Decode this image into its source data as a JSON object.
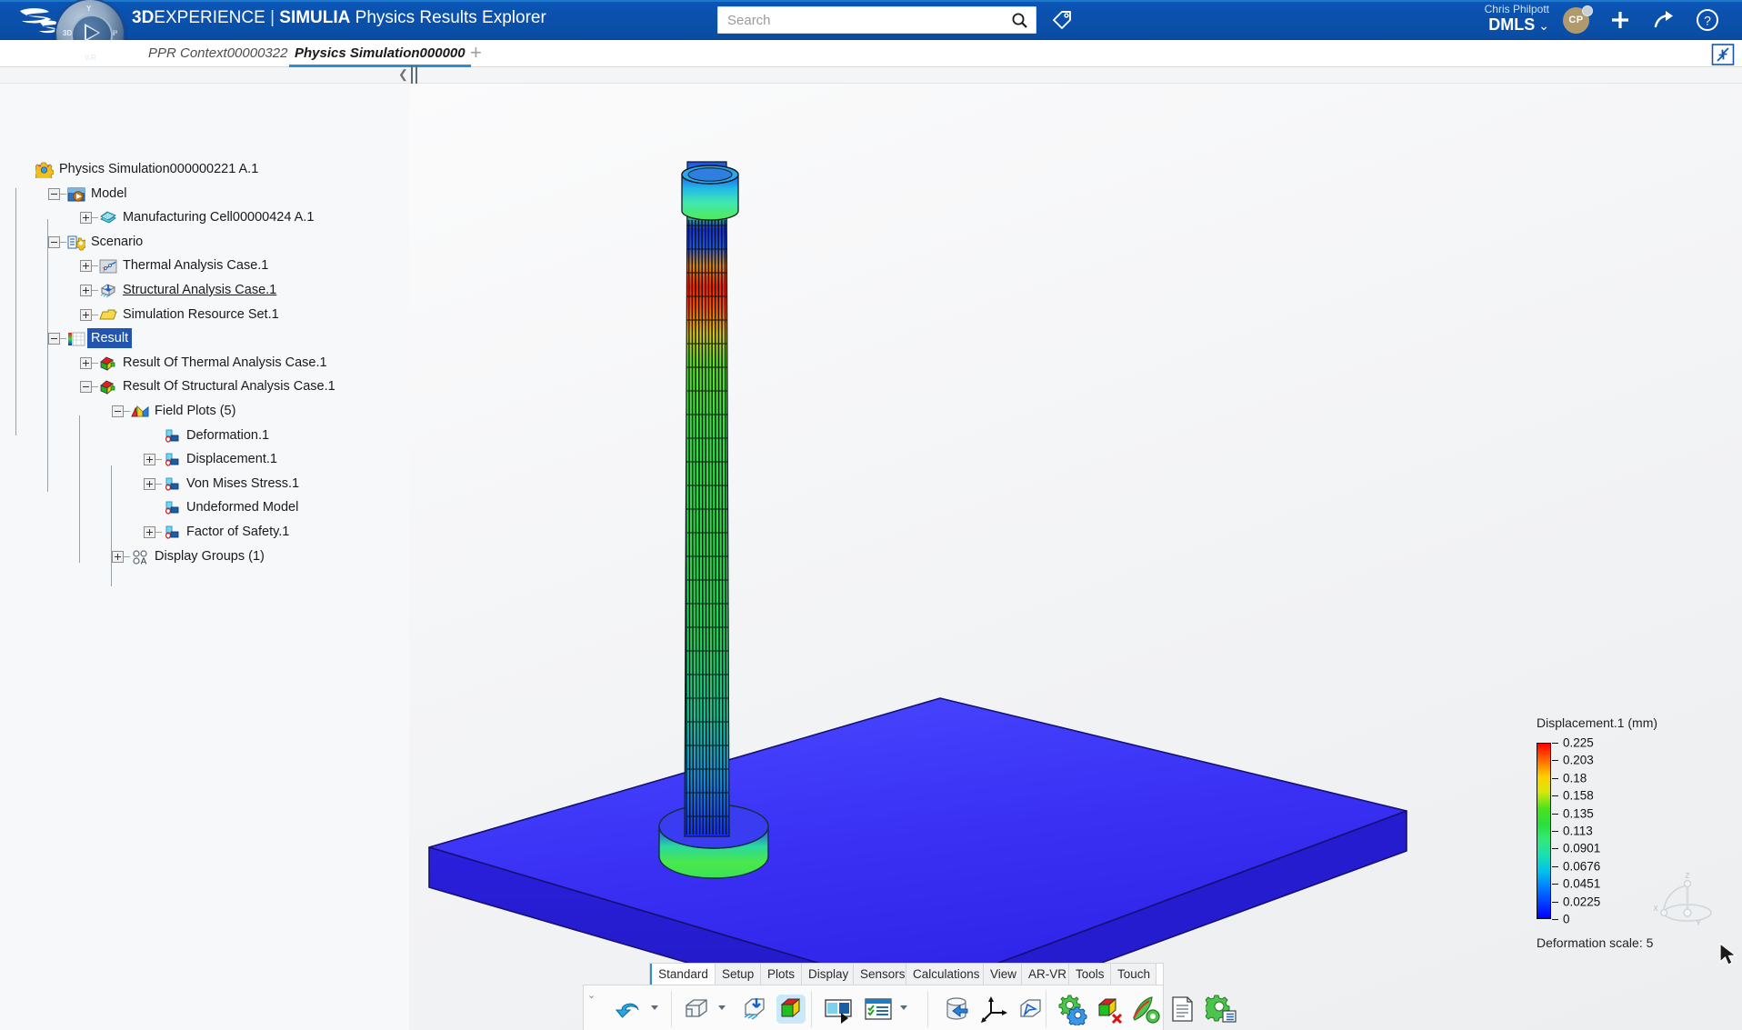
{
  "topbar": {
    "brand_bold": "3D",
    "brand_rest": "EXPERIENCE",
    "brand_sep": "|",
    "brand_product": "SIMULIA",
    "brand_app": "Physics Results Explorer",
    "compass_labels": {
      "n": "Y",
      "w": "3D",
      "e": "i³",
      "s": "V,R"
    },
    "search_placeholder": "Search",
    "search_value": "",
    "user_name": "Chris Philpott",
    "user_org": "DMLS",
    "avatar_initials": "CP",
    "icons": {
      "search": "search-icon",
      "tag": "tag-icon",
      "plus": "plus-icon",
      "share": "share-icon",
      "help": "help-icon",
      "collapse": "collapse-icon"
    }
  },
  "tabs": {
    "inactive_label": "PPR Context00000322",
    "active_label": "Physics Simulation000000",
    "add_label": "+"
  },
  "tree": {
    "nodes": [
      {
        "label": "Physics Simulation000000221 A.1",
        "indent": 0,
        "icon": "simulation-gear-icon",
        "expander": "none",
        "state": "normal"
      },
      {
        "label": "Model",
        "indent": 1,
        "icon": "model-play-icon",
        "expander": "minus",
        "state": "normal"
      },
      {
        "label": "Manufacturing Cell00000424 A.1",
        "indent": 2,
        "icon": "manufacturing-cell-icon",
        "expander": "plus",
        "state": "normal"
      },
      {
        "label": "Scenario",
        "indent": 1,
        "icon": "scenario-icon",
        "expander": "minus",
        "state": "normal"
      },
      {
        "label": "Thermal Analysis Case.1",
        "indent": 2,
        "icon": "thermal-case-icon",
        "expander": "plus",
        "state": "normal"
      },
      {
        "label": "Structural Analysis Case.1",
        "indent": 2,
        "icon": "structural-case-icon",
        "expander": "plus",
        "state": "underline"
      },
      {
        "label": "Simulation Resource Set.1",
        "indent": 2,
        "icon": "folder-icon",
        "expander": "plus",
        "state": "normal"
      },
      {
        "label": "Result",
        "indent": 1,
        "icon": "result-icon",
        "expander": "minus",
        "state": "selected"
      },
      {
        "label": "Result Of Thermal Analysis Case.1",
        "indent": 2,
        "icon": "result-cube-icon",
        "expander": "plus",
        "state": "normal"
      },
      {
        "label": "Result Of Structural Analysis Case.1",
        "indent": 2,
        "icon": "result-cube-icon",
        "expander": "minus",
        "state": "normal"
      },
      {
        "label": "Field Plots (5)",
        "indent": 3,
        "icon": "field-plots-icon",
        "expander": "minus",
        "state": "normal"
      },
      {
        "label": "Deformation.1",
        "indent": 4,
        "icon": "plot-icon",
        "expander": "none",
        "state": "normal"
      },
      {
        "label": "Displacement.1",
        "indent": 4,
        "icon": "plot-icon",
        "expander": "plus",
        "state": "normal"
      },
      {
        "label": "Von Mises Stress.1",
        "indent": 4,
        "icon": "plot-icon",
        "expander": "plus",
        "state": "normal"
      },
      {
        "label": "Undeformed Model",
        "indent": 4,
        "icon": "plot-icon",
        "expander": "none",
        "state": "normal"
      },
      {
        "label": "Factor of Safety.1",
        "indent": 4,
        "icon": "plot-icon",
        "expander": "plus",
        "state": "normal"
      },
      {
        "label": "Display Groups (1)",
        "indent": 3,
        "icon": "display-groups-icon",
        "expander": "plus",
        "state": "normal"
      }
    ]
  },
  "legend": {
    "title": "Displacement.1 (mm)",
    "values": [
      "0.225",
      "0.203",
      "0.18",
      "0.158",
      "0.135",
      "0.113",
      "0.0901",
      "0.0676",
      "0.0451",
      "0.0225",
      "0"
    ],
    "deformation_scale_label": "Deformation scale: 5",
    "colors": {
      "max": "#ff0000",
      "mid": "#33e878",
      "min": "#0000ff"
    }
  },
  "triad": {
    "x": "X",
    "y": "Y",
    "z": "Z"
  },
  "bottom_toolbar": {
    "tabs": [
      {
        "label": "Standard",
        "active": true
      },
      {
        "label": "Setup",
        "active": false
      },
      {
        "label": "Plots",
        "active": false
      },
      {
        "label": "Display",
        "active": false
      },
      {
        "label": "Sensors",
        "active": false
      },
      {
        "label": "Calculations",
        "active": false
      },
      {
        "label": "View",
        "active": false
      },
      {
        "label": "AR-VR",
        "active": false
      },
      {
        "label": "Tools",
        "active": false
      },
      {
        "label": "Touch",
        "active": false
      }
    ],
    "buttons": [
      {
        "name": "undo-icon",
        "title": "Undo"
      },
      {
        "name": "import-shape-icon",
        "title": "Shape"
      },
      {
        "name": "import-result-icon",
        "title": "Import Result"
      },
      {
        "name": "color-plot-icon",
        "title": "Color Plot"
      },
      {
        "name": "animation-icon",
        "title": "Animation"
      },
      {
        "name": "plot-list-icon",
        "title": "Plot List"
      },
      {
        "name": "database-import-icon",
        "title": "Load Database"
      },
      {
        "name": "axis-triad-icon",
        "title": "Axis System"
      },
      {
        "name": "probe-icon",
        "title": "Probe"
      },
      {
        "name": "settings-gears-icon",
        "title": "Settings"
      },
      {
        "name": "delete-plot-icon",
        "title": "Delete Plot"
      },
      {
        "name": "annotate-icon",
        "title": "Annotate"
      },
      {
        "name": "report-icon",
        "title": "Report"
      },
      {
        "name": "options-list-icon",
        "title": "Options"
      }
    ]
  },
  "viewport": {
    "model_description": "Deformed lattice column on base plate, colored by displacement",
    "base_plate_color": "#3333ff",
    "background": "#f2f3f5"
  }
}
